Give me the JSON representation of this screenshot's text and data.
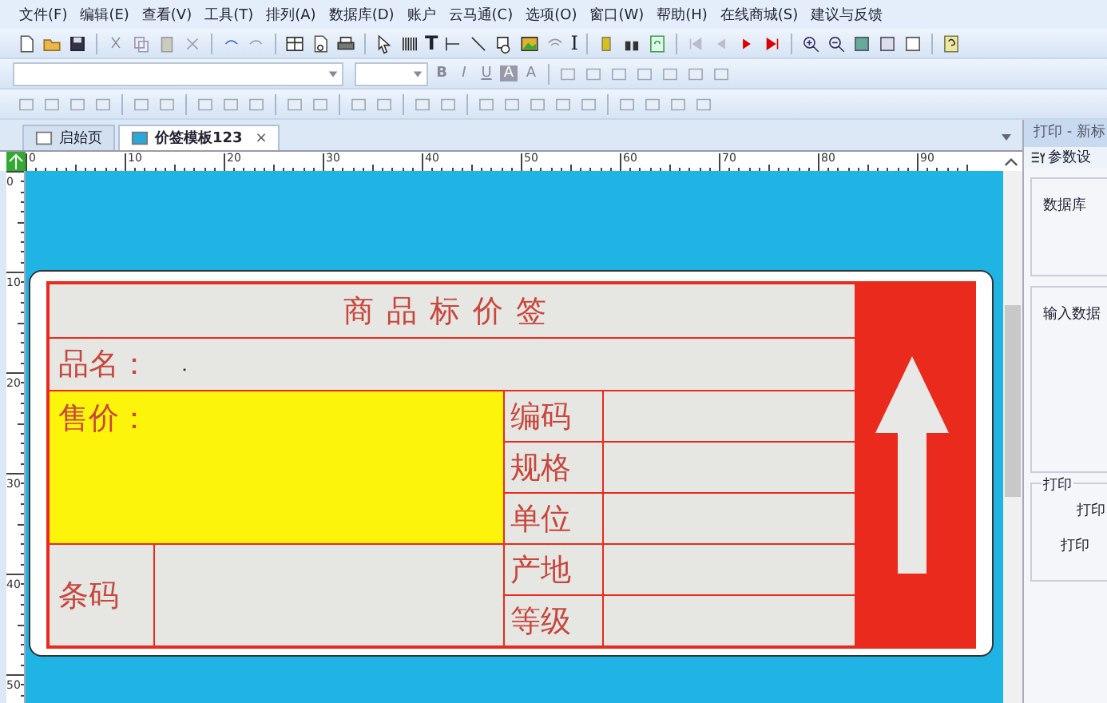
{
  "menu": [
    "文件(F)",
    "编辑(E)",
    "查看(V)",
    "工具(T)",
    "排列(A)",
    "数据库(D)",
    "账户",
    "云马通(C)",
    "选项(O)",
    "窗口(W)",
    "帮助(H)",
    "在线商城(S)",
    "建议与反馈"
  ],
  "toolbar": {
    "text_tool": "T",
    "cursor_tool": "I"
  },
  "format_buttons": [
    {
      "label": "B",
      "kind": "bold"
    },
    {
      "label": "I",
      "kind": "italic"
    },
    {
      "label": "U",
      "kind": "underline"
    },
    {
      "label": "A",
      "kind": "highlight"
    },
    {
      "label": "A",
      "kind": "color"
    }
  ],
  "tabs": [
    {
      "label": "启始页",
      "selected": false
    },
    {
      "label": "价签模板123",
      "selected": true,
      "closable": true
    }
  ],
  "close_glyph": "×",
  "ruler_h": [
    "0",
    "10",
    "20",
    "30",
    "40",
    "50",
    "60",
    "70",
    "80",
    "90"
  ],
  "ruler_v": [
    "0",
    "10",
    "20",
    "30",
    "40",
    "50"
  ],
  "label": {
    "title": "商品标价签",
    "name_label": "品名：",
    "name_value": ".",
    "price_label": "售价：",
    "barcode_label": "条码",
    "fields": [
      "编码",
      "规格",
      "单位",
      "产地",
      "等级"
    ]
  },
  "right_panel": {
    "title": "打印 - 新标",
    "tab": "参数设",
    "groups": [
      {
        "title": "数据库"
      },
      {
        "title": "输入数据"
      },
      {
        "title": "打印",
        "items": [
          "打印",
          "打印"
        ]
      }
    ]
  }
}
